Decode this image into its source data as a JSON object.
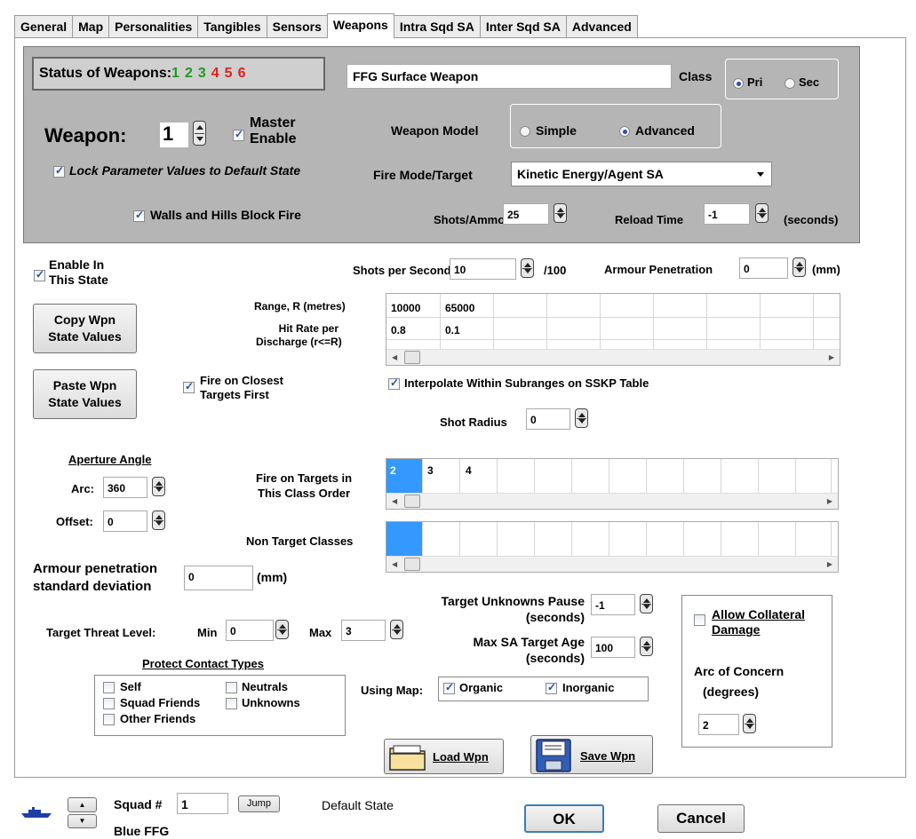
{
  "tabs": [
    "General",
    "Map",
    "Personalities",
    "Tangibles",
    "Sensors",
    "Weapons",
    "Intra Sqd SA",
    "Inter Sqd SA",
    "Advanced"
  ],
  "active_tab": "Weapons",
  "status": {
    "label": "Status of Weapons:",
    "digits": [
      {
        "text": "1",
        "color": "#1d9a1d"
      },
      {
        "text": "2",
        "color": "#1d9a1d"
      },
      {
        "text": "3",
        "color": "#1d9a1d"
      },
      {
        "text": "4",
        "color": "#e3211c"
      },
      {
        "text": "5",
        "color": "#e3211c"
      },
      {
        "text": "6",
        "color": "#e3211c"
      }
    ]
  },
  "weapon_name": "FFG Surface Weapon",
  "class_label": "Class",
  "class_pri": "Pri",
  "class_sec": "Sec",
  "weapon_label": "Weapon:",
  "weapon_number": "1",
  "master_enable": "Master Enable",
  "master_enable_1": "Master",
  "master_enable_2": "Enable",
  "weapon_model_label": "Weapon Model",
  "model_simple": "Simple",
  "model_advanced": "Advanced",
  "lock_params": "Lock Parameter Values to Default State",
  "fire_mode_label": "Fire Mode/Target",
  "fire_mode_value": "Kinetic Energy/Agent SA",
  "walls_block": "Walls and Hills Block Fire",
  "shots_ammo_label": "Shots/Ammo",
  "shots_ammo_value": "25",
  "reload_label": "Reload Time",
  "reload_value": "-1",
  "reload_unit": "(seconds)",
  "enable_state_1": "Enable In",
  "enable_state_2": "This State",
  "shots_per_second_label": "Shots per Second",
  "shots_per_second_value": "10",
  "shots_per_second_unit": "/100",
  "armour_pen_label": "Armour Penetration",
  "armour_pen_value": "0",
  "armour_pen_unit": "(mm)",
  "copy_btn_1": "Copy Wpn",
  "copy_btn_2": "State Values",
  "paste_btn_1": "Paste Wpn",
  "paste_btn_2": "State Values",
  "range_label": "Range, R (metres)",
  "hit_rate_label_1": "Hit Rate per",
  "hit_rate_label_2": "Discharge (r<=R)",
  "range_values": [
    "10000",
    "65000"
  ],
  "hit_values": [
    "0.8",
    "0.1"
  ],
  "fire_closest_1": "Fire on Closest",
  "fire_closest_2": "Targets First",
  "interpolate": "Interpolate Within Subranges on SSKP Table",
  "shot_radius_label": "Shot Radius",
  "shot_radius_value": "0",
  "aperture_title": "Aperture Angle",
  "arc_label": "Arc:",
  "arc_value": "360",
  "offset_label": "Offset:",
  "offset_value": "0",
  "fire_order_1": "Fire on Targets in",
  "fire_order_2": "This Class Order",
  "class_order": [
    "2",
    "3",
    "4"
  ],
  "non_target_label": "Non Target Classes",
  "armour_sd_1": "Armour penetration",
  "armour_sd_2": "standard deviation",
  "armour_sd_value": "0",
  "armour_sd_unit": "(mm)",
  "threat_label": "Target Threat Level:",
  "threat_min_label": "Min",
  "threat_min_value": "0",
  "threat_max_label": "Max",
  "threat_max_value": "3",
  "unknowns_pause_1": "Target Unknowns Pause",
  "unknowns_pause_2": "(seconds)",
  "unknowns_pause_value": "-1",
  "max_sa_1": "Max SA Target Age",
  "max_sa_2": "(seconds)",
  "max_sa_value": "100",
  "collateral_1": "Allow Collateral",
  "collateral_2": "Damage",
  "arc_concern_1": "Arc of Concern",
  "arc_concern_2": "(degrees)",
  "arc_concern_value": "2",
  "protect_title": "Protect Contact Types",
  "protect": {
    "self": "Self",
    "neutrals": "Neutrals",
    "squad_friends": "Squad Friends",
    "unknowns": "Unknowns",
    "other_friends": "Other Friends"
  },
  "using_map_label": "Using Map:",
  "organic": "Organic",
  "inorganic": "Inorganic",
  "load_btn": "Load Wpn",
  "save_btn": "Save Wpn",
  "footer": {
    "squad_label": "Squad #",
    "squad_value": "1",
    "jump": "Jump",
    "state": "Default State",
    "squad_name": "Blue FFG",
    "ok": "OK",
    "cancel": "Cancel"
  },
  "colors": {
    "panel": "#b5b5b5",
    "selected_cell": "#3399ff",
    "check": "#2b4fa0"
  }
}
